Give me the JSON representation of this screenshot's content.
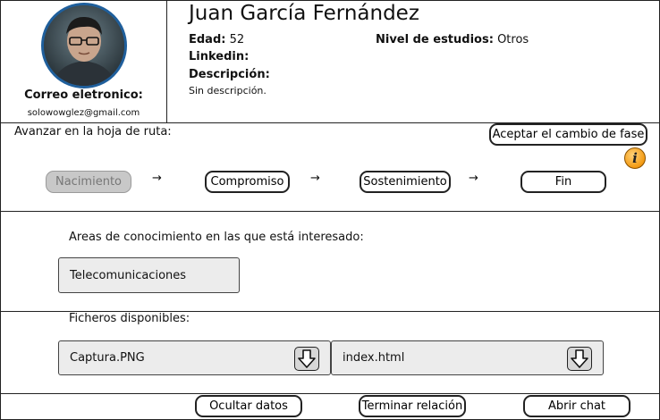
{
  "profile": {
    "name": "Juan García Fernández",
    "email_label": "Correo eletronico:",
    "email": "solowowglez@gmail.com",
    "age_label": "Edad:",
    "age": "52",
    "education_label": "Nivel de estudios:",
    "education": "Otros",
    "linkedin_label": "Linkedin:",
    "description_label": "Descripción:",
    "description": "Sin descripción."
  },
  "roadmap": {
    "title": "Avanzar en la hoja de ruta:",
    "accept_label": "Aceptar el cambio de fase",
    "info_glyph": "i",
    "arrow": "→",
    "phases": [
      {
        "label": "Nacimiento",
        "state": "disabled"
      },
      {
        "label": "Compromiso",
        "state": "enabled"
      },
      {
        "label": "Sostenimiento",
        "state": "enabled"
      },
      {
        "label": "Fin",
        "state": "enabled"
      }
    ]
  },
  "areas": {
    "title": "Areas de conocimiento en las que está interesado:",
    "items": [
      "Telecomunicaciones"
    ]
  },
  "files": {
    "title": "Ficheros disponibles:",
    "items": [
      "Captura.PNG",
      "index.html"
    ],
    "download_icon": "download-arrow-icon"
  },
  "footer": {
    "hide_label": "Ocultar datos",
    "end_label": "Terminar relación",
    "chat_label": "Abrir chat"
  },
  "colors": {
    "avatar_ring": "#1f5f9c",
    "disabled_phase": "#c8c8c8",
    "info_icon": "#f39a12",
    "field_box": "#ececec"
  }
}
